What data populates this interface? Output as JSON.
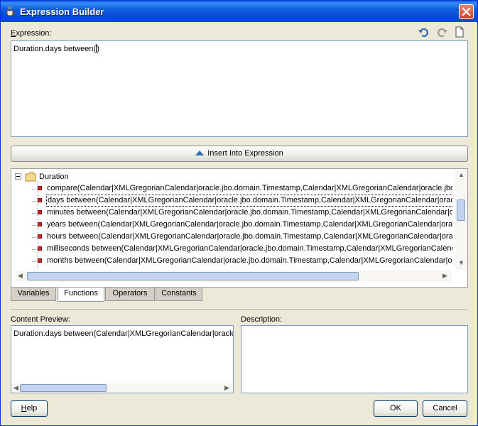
{
  "window": {
    "title": "Expression Builder",
    "title_icon": "coffee-cup-icon",
    "close_icon": "close-icon"
  },
  "expression": {
    "label": "Expression:",
    "value": "Duration.days between()",
    "toolbar": [
      "undo-icon",
      "redo-icon",
      "new-document-icon"
    ]
  },
  "insert_button": {
    "label": "Insert Into Expression",
    "icon": "up-arrow-icon"
  },
  "tree": {
    "root": "Duration",
    "items": [
      "compare(Calendar|XMLGregorianCalendar|oracle.jbo.domain.Timestamp,Calendar|XMLGregorianCalendar|oracle.jbo.",
      "days between(Calendar|XMLGregorianCalendar|oracle.jbo.domain.Timestamp,Calendar|XMLGregorianCalendar|oracle",
      "minutes between(Calendar|XMLGregorianCalendar|oracle.jbo.domain.Timestamp,Calendar|XMLGregorianCalendar|or",
      "years between(Calendar|XMLGregorianCalendar|oracle.jbo.domain.Timestamp,Calendar|XMLGregorianCalendar|orac",
      "hours between(Calendar|XMLGregorianCalendar|oracle.jbo.domain.Timestamp,Calendar|XMLGregorianCalendar|orac",
      "milliseconds between(Calendar|XMLGregorianCalendar|oracle.jbo.domain.Timestamp,Calendar|XMLGregorianCalenda",
      "months between(Calendar|XMLGregorianCalendar|oracle.jbo.domain.Timestamp,Calendar|XMLGregorianCalendar|ora"
    ],
    "selected_index": 1
  },
  "tabs": [
    "Variables",
    "Functions",
    "Operators",
    "Constants"
  ],
  "active_tab": "Functions",
  "content_preview": {
    "label": "Content Preview:",
    "value": "Duration.days between(Calendar|XMLGregorianCalendar|oracle."
  },
  "description": {
    "label": "Description:"
  },
  "buttons": {
    "help": "Help",
    "ok": "OK",
    "cancel": "Cancel"
  },
  "colors": {
    "titlebar": "#0a5fe8",
    "accent": "#2e6bb8",
    "function_icon": "#d12a2a"
  }
}
